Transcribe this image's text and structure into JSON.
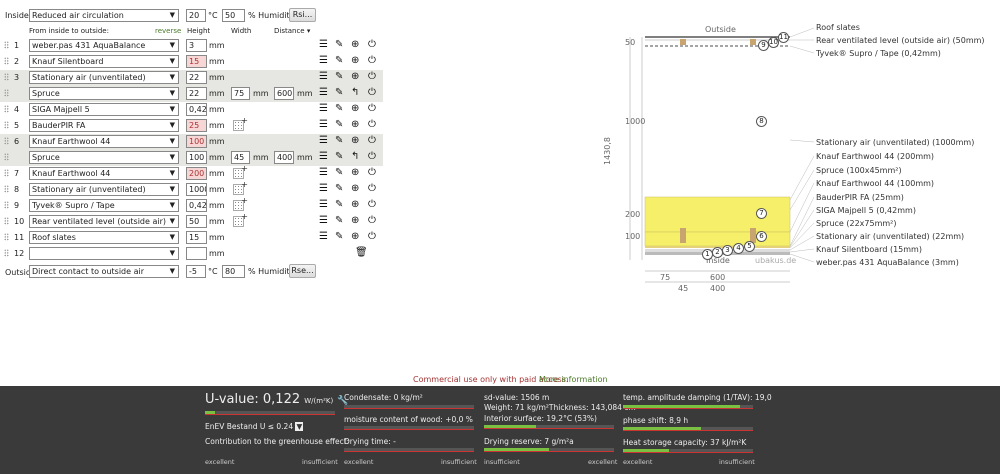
{
  "inside": {
    "label": "Inside:",
    "select": "Reduced air circulation",
    "temp": "20",
    "temp_unit": "°C",
    "humidity": "50",
    "humidity_unit": "% Humidity",
    "rsi_button": "Rsi..."
  },
  "headers": {
    "from_inside": "From inside to outside:",
    "reverse": "reverse",
    "height": "Height",
    "width": "Width",
    "distance": "Distance ▾"
  },
  "units": {
    "mm": "mm"
  },
  "rows": [
    {
      "num": "1",
      "material": "weber.pas 431 AquaBalance",
      "height": "3"
    },
    {
      "num": "2",
      "material": "Knauf Silentboard",
      "height": "15"
    },
    {
      "num": "3",
      "material": "Stationary air (unventilated)",
      "height": "22"
    },
    {
      "num": "",
      "material": "Spruce",
      "height": "22",
      "width": "75",
      "distance": "600"
    },
    {
      "num": "4",
      "material": "SIGA Majpell 5",
      "height": "0,42"
    },
    {
      "num": "5",
      "material": "BauderPIR FA",
      "height": "25"
    },
    {
      "num": "6",
      "material": "Knauf Earthwool 44",
      "height": "100"
    },
    {
      "num": "",
      "material": "Spruce",
      "height": "100",
      "width": "45",
      "distance": "400"
    },
    {
      "num": "7",
      "material": "Knauf Earthwool 44",
      "height": "200"
    },
    {
      "num": "8",
      "material": "Stationary air (unventilated)",
      "height": "1000"
    },
    {
      "num": "9",
      "material": "Tyvek® Supro / Tape",
      "height": "0,42"
    },
    {
      "num": "10",
      "material": "Rear ventilated level (outside air)",
      "height": "50"
    },
    {
      "num": "11",
      "material": "Roof slates",
      "height": "15"
    },
    {
      "num": "12",
      "material": "",
      "height": ""
    }
  ],
  "outside": {
    "label": "Outside",
    "select": "Direct contact to outside air",
    "temp": "-5",
    "temp_unit": "°C",
    "humidity": "80",
    "humidity_unit": "% Humidity",
    "rse_button": "Rse..."
  },
  "diagram": {
    "outside_label": "Outside",
    "inside_label": "Inside",
    "watermark": "ubakus.de",
    "dim_50": "50",
    "dim_1000": "1000",
    "dim_1430": "1430,8",
    "dim_200": "200",
    "dim_100": "100",
    "dim_75": "75",
    "dim_600": "600",
    "dim_45": "45",
    "dim_400": "400",
    "circles": [
      "1",
      "2",
      "3",
      "4",
      "5",
      "6",
      "7",
      "8",
      "9",
      "10",
      "11"
    ],
    "layer_labels": [
      "Roof slates",
      "Rear ventilated level (outside air) (50mm)",
      "Tyvek® Supro / Tape (0,42mm)",
      "Stationary air (unventilated) (1000mm)",
      "Knauf Earthwool 44 (200mm)",
      "Spruce (100x45mm²)",
      "Knauf Earthwool 44 (100mm)",
      "BauderPIR FA (25mm)",
      "SIGA Majpell 5 (0,42mm)",
      "Spruce (22x75mm²)",
      "Stationary air (unventilated) (22mm)",
      "Knauf Silentboard (15mm)",
      "weber.pas 431 AquaBalance (3mm)"
    ]
  },
  "notice": {
    "text": "Commercial use only with paid access.",
    "link": "More information"
  },
  "footer": {
    "uvalue_label": "U-value:",
    "uvalue": "0,122",
    "uvalue_unit": "W/(m²K)",
    "enev": "EnEV Bestand U ≤ 0.24",
    "greenhouse": "Contribution to the greenhouse effect:",
    "condensate": "Condensate: 0 kg/m²",
    "moisture": "moisture content of wood: +0,0 %",
    "drying_time": "Drying time: -",
    "sd_value": "sd-value: 1506 m",
    "weight": "Weight: 71 kg/m²Thickness: 143,084 cm",
    "interior": "Interior surface: 19,2°C (53%)",
    "drying_reserve": "Drying reserve: 7 g/m²a",
    "damping": "temp. amplitude damping (1/TAV): 19,0",
    "phase": "phase shift: 8,9 h",
    "heat_storage": "Heat storage capacity: 37 kJ/m²K",
    "excellent": "excellent",
    "insufficient": "insufficient",
    "bars": {
      "uvalue": 0.08,
      "condensate": 0.0,
      "moisture": 0.0,
      "drying_time": 0.0,
      "drying_reserve": 0.5,
      "interior": 0.4,
      "damping": 0.9,
      "phase": 0.6,
      "heat_storage": 0.35
    }
  },
  "colors": {
    "insulation": "#f5ef6a",
    "spruce": "#c8a46e",
    "footer_bg": "#3a3a3a",
    "notice": "#a33333",
    "link": "#4a7a2a",
    "bar_fill": "#7ac143"
  }
}
